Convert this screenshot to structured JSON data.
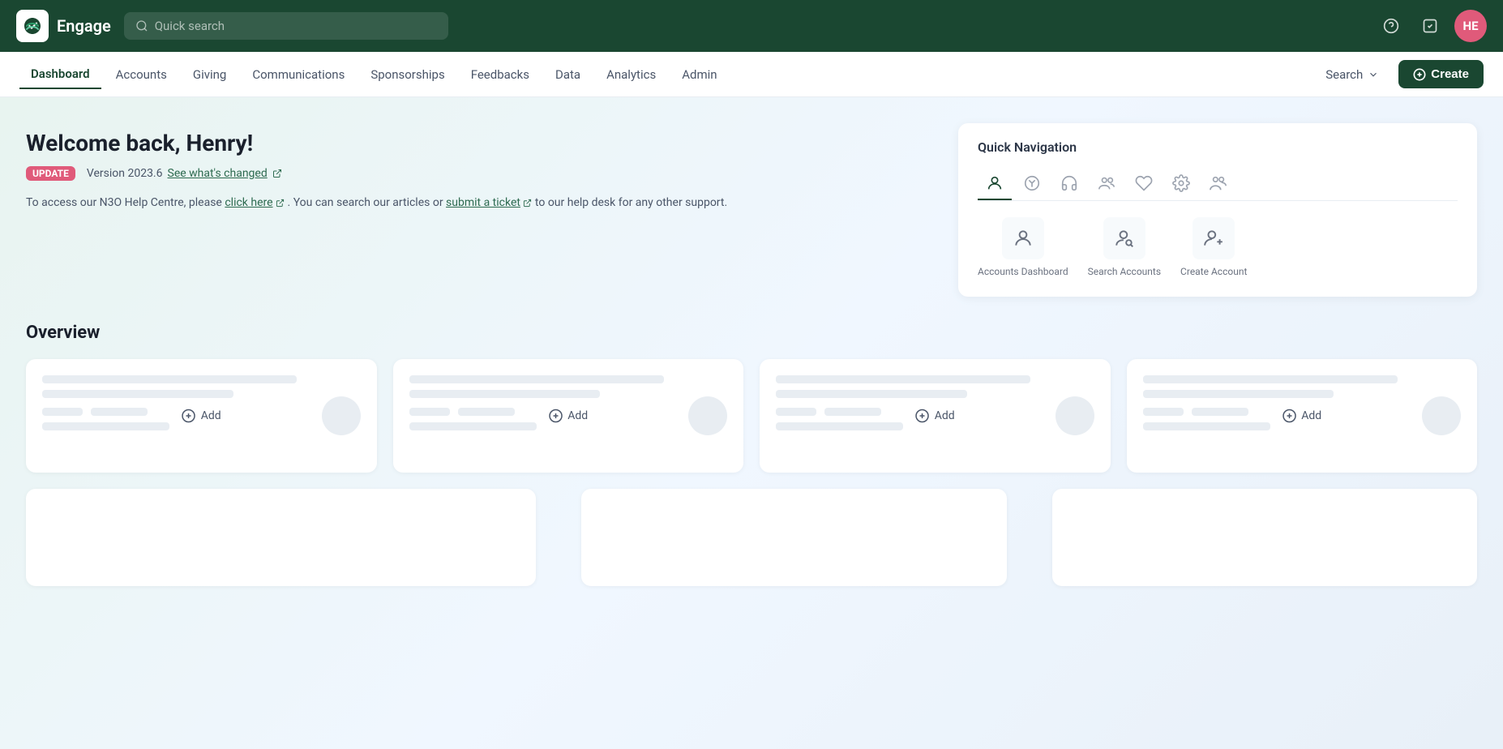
{
  "app": {
    "name": "Engage",
    "logo_icon": "~"
  },
  "topnav": {
    "quick_search_placeholder": "Quick search",
    "help_icon": "?",
    "task_icon": "✓",
    "user_initials": "HE"
  },
  "secnav": {
    "items": [
      {
        "id": "dashboard",
        "label": "Dashboard",
        "active": true
      },
      {
        "id": "accounts",
        "label": "Accounts",
        "active": false
      },
      {
        "id": "giving",
        "label": "Giving",
        "active": false
      },
      {
        "id": "communications",
        "label": "Communications",
        "active": false
      },
      {
        "id": "sponsorships",
        "label": "Sponsorships",
        "active": false
      },
      {
        "id": "feedbacks",
        "label": "Feedbacks",
        "active": false
      },
      {
        "id": "data",
        "label": "Data",
        "active": false
      },
      {
        "id": "analytics",
        "label": "Analytics",
        "active": false
      },
      {
        "id": "admin",
        "label": "Admin",
        "active": false
      }
    ],
    "search_label": "Search",
    "create_label": "Create"
  },
  "welcome": {
    "heading": "Welcome back, Henry!",
    "badge": "UPDATE",
    "version": "Version 2023.6",
    "see_changes": "See what's changed",
    "help_text_1": "To access our N3O Help Centre, please",
    "click_here": "click here",
    "help_text_2": ". You can search our articles or",
    "submit_ticket": "submit a ticket",
    "help_text_3": "to our help desk for any other support."
  },
  "quick_nav": {
    "title": "Quick Navigation",
    "items": [
      {
        "id": "accounts-dashboard",
        "label": "Accounts Dashboard"
      },
      {
        "id": "search-accounts",
        "label": "Search Accounts"
      },
      {
        "id": "create-account",
        "label": "Create Account"
      }
    ]
  },
  "overview": {
    "title": "Overview",
    "cards": [
      {
        "id": "card-1",
        "add_label": "Add"
      },
      {
        "id": "card-2",
        "add_label": "Add"
      },
      {
        "id": "card-3",
        "add_label": "Add"
      },
      {
        "id": "card-4",
        "add_label": "Add"
      }
    ]
  }
}
